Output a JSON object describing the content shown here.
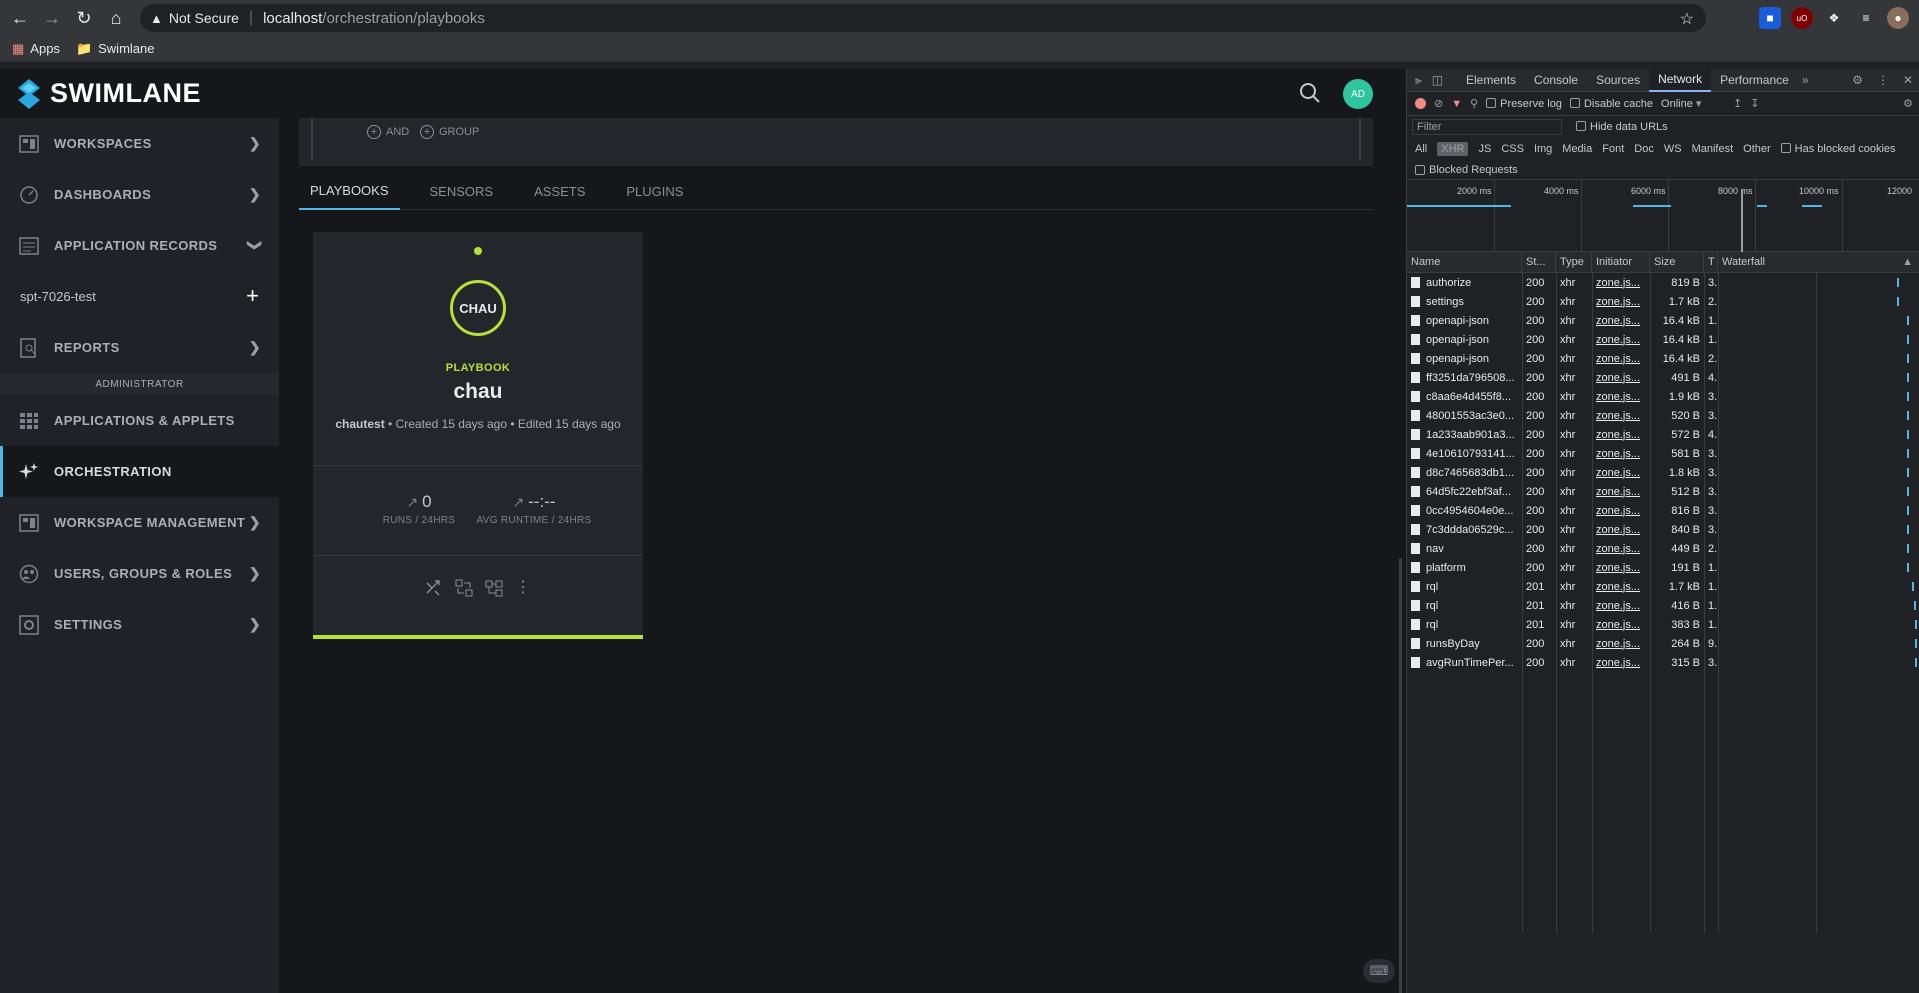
{
  "browser": {
    "security_label": "Not Secure",
    "url_host": "localhost",
    "url_path": "/orchestration/playbooks",
    "bookmarks": [
      {
        "label": "Apps"
      },
      {
        "label": "Swimlane"
      }
    ]
  },
  "app": {
    "brand": "SWIMLANE",
    "avatar_initials": "AD",
    "nav": [
      {
        "label": "WORKSPACES",
        "icon": "workspaces-icon"
      },
      {
        "label": "DASHBOARDS",
        "icon": "dashboard-gauge-icon"
      },
      {
        "label": "APPLICATION RECORDS",
        "icon": "records-icon"
      }
    ],
    "sub_item": "spt-7026-test",
    "reports": "REPORTS",
    "admin_label": "ADMINISTRATOR",
    "admin_nav": [
      {
        "label": "APPLICATIONS & APPLETS"
      },
      {
        "label": "ORCHESTRATION"
      },
      {
        "label": "WORKSPACE MANAGEMENT"
      },
      {
        "label": "USERS, GROUPS & ROLES"
      },
      {
        "label": "SETTINGS"
      }
    ],
    "filter": {
      "and_label": "AND",
      "group_label": "GROUP"
    },
    "tabs": [
      "PLAYBOOKS",
      "SENSORS",
      "ASSETS",
      "PLUGINS"
    ],
    "card": {
      "badge": "CHAU",
      "kind": "PLAYBOOK",
      "name": "chau",
      "owner": "chautest",
      "created": "Created 15 days ago",
      "edited": "Edited 15 days ago",
      "runs_value": "0",
      "runs_label": "RUNS / 24HRS",
      "avg_value": "--:--",
      "avg_label": "AVG RUNTIME / 24HRS",
      "status_color": "#b5e23a"
    }
  },
  "devtools": {
    "tabs": [
      "Elements",
      "Console",
      "Sources",
      "Network",
      "Performance"
    ],
    "active_tab": "Network",
    "preserve_log": "Preserve log",
    "disable_cache": "Disable cache",
    "throttle": "Online",
    "filter_placeholder": "Filter",
    "hide_data_urls": "Hide data URLs",
    "types": [
      "All",
      "XHR",
      "JS",
      "CSS",
      "Img",
      "Media",
      "Font",
      "Doc",
      "WS",
      "Manifest",
      "Other"
    ],
    "has_blocked": "Has blocked cookies",
    "blocked_requests": "Blocked Requests",
    "timeline_ticks": [
      "2000 ms",
      "4000 ms",
      "6000 ms",
      "8000 ms",
      "10000 ms",
      "12000"
    ],
    "columns": [
      "Name",
      "St...",
      "Type",
      "Initiator",
      "Size",
      "T",
      "Waterfall"
    ],
    "requests": [
      {
        "name": "authorize",
        "status": "200",
        "type": "xhr",
        "initiator": "zone.js...",
        "size": "819 B",
        "t": "3."
      },
      {
        "name": "settings",
        "status": "200",
        "type": "xhr",
        "initiator": "zone.js...",
        "size": "1.7 kB",
        "t": "2."
      },
      {
        "name": "openapi-json",
        "status": "200",
        "type": "xhr",
        "initiator": "zone.js...",
        "size": "16.4 kB",
        "t": "1."
      },
      {
        "name": "openapi-json",
        "status": "200",
        "type": "xhr",
        "initiator": "zone.js...",
        "size": "16.4 kB",
        "t": "1."
      },
      {
        "name": "openapi-json",
        "status": "200",
        "type": "xhr",
        "initiator": "zone.js...",
        "size": "16.4 kB",
        "t": "2."
      },
      {
        "name": "ff3251da796508...",
        "status": "200",
        "type": "xhr",
        "initiator": "zone.js...",
        "size": "491 B",
        "t": "4."
      },
      {
        "name": "c8aa6e4d455f8...",
        "status": "200",
        "type": "xhr",
        "initiator": "zone.js...",
        "size": "1.9 kB",
        "t": "3."
      },
      {
        "name": "48001553ac3e0...",
        "status": "200",
        "type": "xhr",
        "initiator": "zone.js...",
        "size": "520 B",
        "t": "3."
      },
      {
        "name": "1a233aab901a3...",
        "status": "200",
        "type": "xhr",
        "initiator": "zone.js...",
        "size": "572 B",
        "t": "4."
      },
      {
        "name": "4e10610793141...",
        "status": "200",
        "type": "xhr",
        "initiator": "zone.js...",
        "size": "581 B",
        "t": "3."
      },
      {
        "name": "d8c7465683db1...",
        "status": "200",
        "type": "xhr",
        "initiator": "zone.js...",
        "size": "1.8 kB",
        "t": "3."
      },
      {
        "name": "64d5fc22ebf3af...",
        "status": "200",
        "type": "xhr",
        "initiator": "zone.js...",
        "size": "512 B",
        "t": "3."
      },
      {
        "name": "0cc4954604e0e...",
        "status": "200",
        "type": "xhr",
        "initiator": "zone.js...",
        "size": "816 B",
        "t": "3."
      },
      {
        "name": "7c3ddda06529c...",
        "status": "200",
        "type": "xhr",
        "initiator": "zone.js...",
        "size": "840 B",
        "t": "3."
      },
      {
        "name": "nav",
        "status": "200",
        "type": "xhr",
        "initiator": "zone.js...",
        "size": "449 B",
        "t": "2."
      },
      {
        "name": "platform",
        "status": "200",
        "type": "xhr",
        "initiator": "zone.js...",
        "size": "191 B",
        "t": "1."
      },
      {
        "name": "rql",
        "status": "201",
        "type": "xhr",
        "initiator": "zone.js...",
        "size": "1.7 kB",
        "t": "1."
      },
      {
        "name": "rql",
        "status": "201",
        "type": "xhr",
        "initiator": "zone.js...",
        "size": "416 B",
        "t": "1."
      },
      {
        "name": "rql",
        "status": "201",
        "type": "xhr",
        "initiator": "zone.js...",
        "size": "383 B",
        "t": "1."
      },
      {
        "name": "runsByDay",
        "status": "200",
        "type": "xhr",
        "initiator": "zone.js...",
        "size": "264 B",
        "t": "9."
      },
      {
        "name": "avgRunTimePer...",
        "status": "200",
        "type": "xhr",
        "initiator": "zone.js...",
        "size": "315 B",
        "t": "3."
      }
    ]
  }
}
